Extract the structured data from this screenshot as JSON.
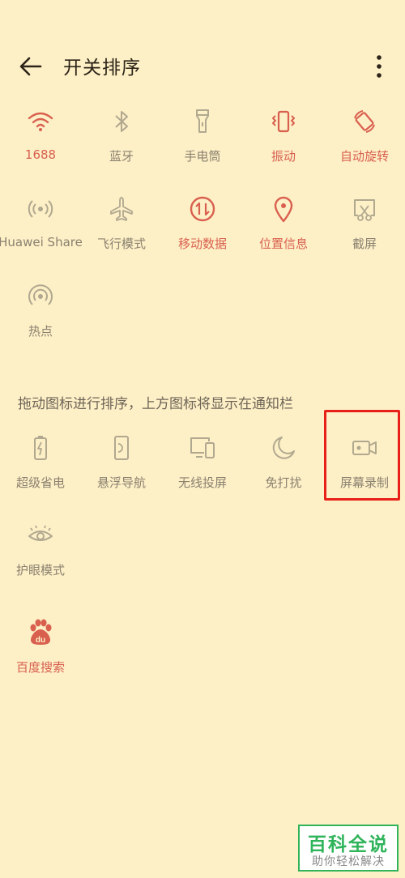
{
  "header": {
    "title": "开关排序",
    "back_icon": "arrow-left-icon",
    "more_icon": "more-vertical-icon"
  },
  "top_toggles": [
    {
      "label": "1688",
      "icon": "wifi-icon",
      "active": true
    },
    {
      "label": "蓝牙",
      "icon": "bluetooth-icon",
      "active": false
    },
    {
      "label": "手电筒",
      "icon": "flashlight-icon",
      "active": false
    },
    {
      "label": "振动",
      "icon": "vibrate-icon",
      "active": true
    },
    {
      "label": "自动旋转",
      "icon": "auto-rotate-icon",
      "active": true
    },
    {
      "label": "Huawei Share",
      "icon": "huawei-share-icon",
      "active": false
    },
    {
      "label": "飞行模式",
      "icon": "airplane-icon",
      "active": false
    },
    {
      "label": "移动数据",
      "icon": "mobile-data-icon",
      "active": true
    },
    {
      "label": "位置信息",
      "icon": "location-icon",
      "active": true
    },
    {
      "label": "截屏",
      "icon": "screenshot-icon",
      "active": false
    },
    {
      "label": "热点",
      "icon": "hotspot-icon",
      "active": false
    }
  ],
  "hint": "拖动图标进行排序，上方图标将显示在通知栏",
  "bottom_toggles": [
    {
      "label": "超级省电",
      "icon": "battery-saver-icon",
      "active": false
    },
    {
      "label": "悬浮导航",
      "icon": "floating-nav-icon",
      "active": false
    },
    {
      "label": "无线投屏",
      "icon": "wireless-projection-icon",
      "active": false
    },
    {
      "label": "免打扰",
      "icon": "moon-icon",
      "active": false
    },
    {
      "label": "屏幕录制",
      "icon": "screen-record-icon",
      "active": false
    },
    {
      "label": "护眼模式",
      "icon": "eye-icon",
      "active": false
    },
    {
      "label": "百度搜索",
      "icon": "baidu-icon",
      "active": true
    }
  ],
  "colors": {
    "background": "#fdefc6",
    "active": "#d9604f",
    "inactive": "#b0a88f",
    "highlight": "#e8201a"
  },
  "watermark": {
    "title": "百科全说",
    "subtitle": "助你轻松解决"
  }
}
